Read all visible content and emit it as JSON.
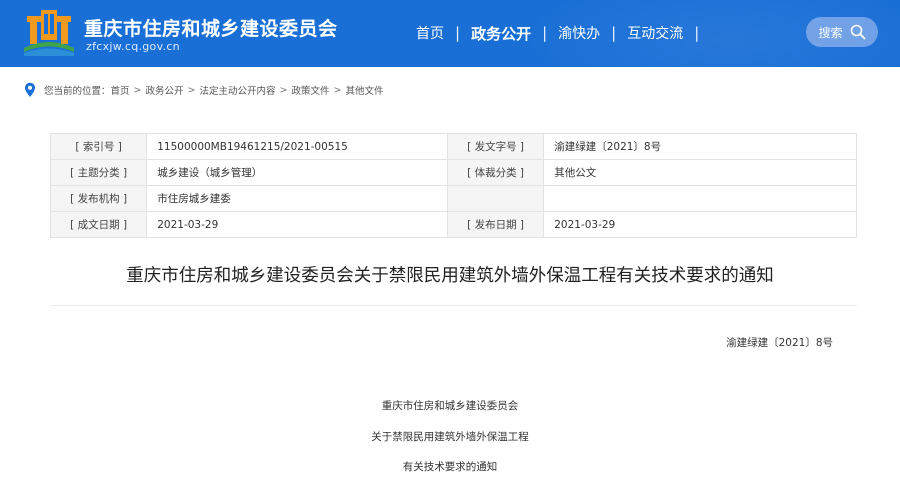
{
  "header": {
    "title": "重庆市住房和城乡建设委员会",
    "domain": "zfcxjw.cq.gov.cn",
    "nav": [
      {
        "label": "首页",
        "active": false
      },
      {
        "label": "政务公开",
        "active": true
      },
      {
        "label": "渝快办",
        "active": false
      },
      {
        "label": "互动交流",
        "active": false
      }
    ],
    "search_label": "搜索"
  },
  "breadcrumb": {
    "prefix": "您当前的位置：",
    "items": [
      "首页",
      "政务公开",
      "法定主动公开内容",
      "政策文件",
      "其他文件"
    ],
    "separator": ">"
  },
  "meta": {
    "rows": [
      {
        "k1": "[ 索引号 ]",
        "v1": "11500000MB19461215/2021-00515",
        "k2": "[ 发文字号 ]",
        "v2": "渝建绿建〔2021〕8号"
      },
      {
        "k1": "[ 主题分类 ]",
        "v1": "城乡建设（城乡管理）",
        "k2": "[ 体裁分类 ]",
        "v2": "其他公文"
      },
      {
        "k1": "[ 发布机构 ]",
        "v1": "市住房城乡建委",
        "k2": "",
        "v2": ""
      },
      {
        "k1": "[ 成文日期 ]",
        "v1": "2021-03-29",
        "k2": "[ 发布日期 ]",
        "v2": "2021-03-29"
      }
    ]
  },
  "document": {
    "title": "重庆市住房和城乡建设委员会关于禁限民用建筑外墙外保温工程有关技术要求的通知",
    "number": "渝建绿建〔2021〕8号",
    "body_lines": [
      "重庆市住房和城乡建设委员会",
      "关于禁限民用建筑外墙外保温工程",
      "有关技术要求的通知"
    ]
  },
  "colors": {
    "header_bg": "#1a6fd6",
    "search_bg": "#6e9fe6",
    "table_key_bg": "#f5f5f5",
    "logo_orange": "#f39a1e",
    "logo_green": "#3fa34d"
  }
}
